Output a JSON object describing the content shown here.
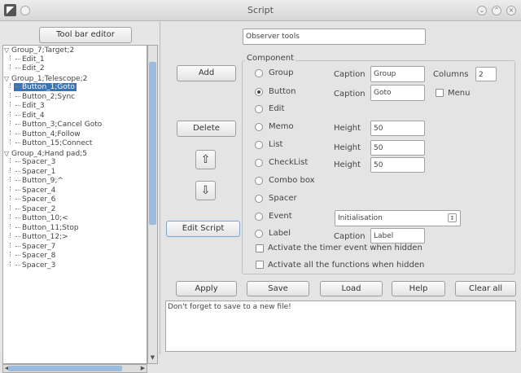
{
  "window": {
    "title": "Script"
  },
  "left": {
    "toolbar_editor_button": "Tool bar editor",
    "tree": [
      {
        "label": "Group_7;Target;2",
        "kind": "group",
        "expanded": true
      },
      {
        "label": "Edit_1",
        "kind": "child"
      },
      {
        "label": "Edit_2",
        "kind": "child"
      },
      {
        "label": "Group_1;Telescope;2",
        "kind": "group",
        "expanded": true
      },
      {
        "label": "Button_1;Goto",
        "kind": "child",
        "selected": true
      },
      {
        "label": "Button_2;Sync",
        "kind": "child"
      },
      {
        "label": "Edit_3",
        "kind": "child"
      },
      {
        "label": "Edit_4",
        "kind": "child"
      },
      {
        "label": "Button_3;Cancel Goto",
        "kind": "child"
      },
      {
        "label": "Button_4;Follow",
        "kind": "child"
      },
      {
        "label": "Button_15;Connect",
        "kind": "child"
      },
      {
        "label": "Group_4;Hand pad;5",
        "kind": "group",
        "expanded": true
      },
      {
        "label": "Spacer_3",
        "kind": "child"
      },
      {
        "label": "Spacer_1",
        "kind": "child"
      },
      {
        "label": "Button_9;^",
        "kind": "child"
      },
      {
        "label": "Spacer_4",
        "kind": "child"
      },
      {
        "label": "Spacer_6",
        "kind": "child"
      },
      {
        "label": "Spacer_2",
        "kind": "child"
      },
      {
        "label": "Button_10;<",
        "kind": "child"
      },
      {
        "label": "Button_11;Stop",
        "kind": "child"
      },
      {
        "label": "Button_12;>",
        "kind": "child"
      },
      {
        "label": "Spacer_7",
        "kind": "child"
      },
      {
        "label": "Spacer_8",
        "kind": "child"
      },
      {
        "label": "Spacer_3",
        "kind": "child"
      }
    ]
  },
  "right": {
    "title_field": "Observer tools",
    "buttons": {
      "add": "Add",
      "delete": "Delete",
      "up_icon": "arrow-up-icon",
      "down_icon": "arrow-down-icon",
      "edit_script": "Edit Script"
    },
    "component": {
      "legend": "Component",
      "options": [
        "Group",
        "Button",
        "Edit",
        "Memo",
        "List",
        "CheckList",
        "Combo box",
        "Spacer",
        "Event",
        "Label"
      ],
      "selected": "Button",
      "group_caption_label": "Caption",
      "group_caption_value": "Group",
      "columns_label": "Columns",
      "columns_value": "2",
      "button_caption_label": "Caption",
      "button_caption_value": "Goto",
      "menu_label": "Menu",
      "menu_checked": false,
      "memo_height_label": "Height",
      "memo_height_value": "50",
      "list_height_label": "Height",
      "list_height_value": "50",
      "checklist_height_label": "Height",
      "checklist_height_value": "50",
      "event_value": "Initialisation",
      "label_caption_label": "Caption",
      "label_caption_value": "Label",
      "timer_label": "Activate the timer event when hidden",
      "timer_checked": false,
      "functions_label": "Activate all the functions when hidden",
      "functions_checked": false
    },
    "bottom_buttons": {
      "apply": "Apply",
      "save": "Save",
      "load": "Load",
      "help": "Help",
      "clear_all": "Clear all"
    },
    "status_text": "Don't forget to save to a new file!"
  }
}
